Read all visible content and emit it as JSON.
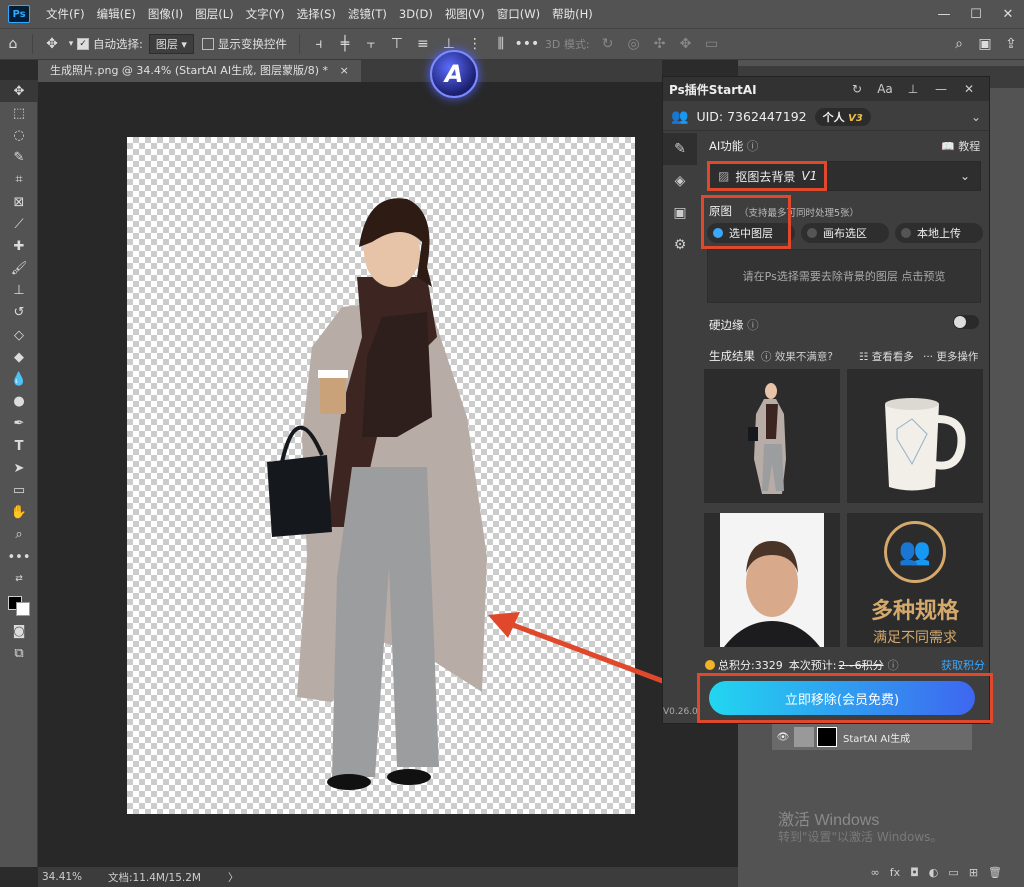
{
  "menubar": {
    "items": [
      "文件(F)",
      "编辑(E)",
      "图像(I)",
      "图层(L)",
      "文字(Y)",
      "选择(S)",
      "滤镜(T)",
      "3D(D)",
      "视图(V)",
      "窗口(W)",
      "帮助(H)"
    ]
  },
  "options": {
    "auto_select_label": "自动选择:",
    "auto_select_value": "图层",
    "show_transform_label": "显示变换控件",
    "mode_3d_label": "3D 模式:"
  },
  "document": {
    "tab_title": "生成照片.png @ 34.4% (StartAI AI生成, 图层蒙版/8) *"
  },
  "statusbar": {
    "zoom": "34.41%",
    "doc_info": "文档:11.4M/15.2M",
    "arrow": "〉"
  },
  "panel": {
    "title": "Ps插件StartAI",
    "uid_label": "UID: 7362447192",
    "plan": "个人",
    "plan_version": "V3",
    "ai_function_label": "AI功能",
    "tutorial": "教程",
    "function_name": "抠图去背景",
    "function_version": "V1",
    "source_label": "原图",
    "source_note": "（支持最多可同时处理5张）",
    "source_options": [
      "选中图层",
      "画布选区",
      "本地上传"
    ],
    "hint": "请在Ps选择需要去除背景的图层 点击预览",
    "hard_edge_label": "硬边缘",
    "results_label": "生成结果",
    "unsatisfied": "效果不满意?",
    "view_more": "查看看多",
    "more_ops": "更多操作",
    "thumb4_title": "多种规格",
    "thumb4_sub": "满足不同需求",
    "points_total": "总积分:3329",
    "points_estimate_label": "本次预计:",
    "points_estimate_value": "2~6积分",
    "get_points": "获取积分",
    "action_button": "立即移除(会员免费)",
    "version": "V0.26.0"
  },
  "layers": {
    "layer_name": "StartAI AI生成"
  },
  "watermark": {
    "title": "激活 Windows",
    "subtitle": "转到\"设置\"以激活 Windows。"
  },
  "colors": {
    "accent_red": "#e0482c",
    "button_gradient_start": "#22d6f0",
    "button_gradient_end": "#3e66f0",
    "link_blue": "#3aa8ff"
  }
}
